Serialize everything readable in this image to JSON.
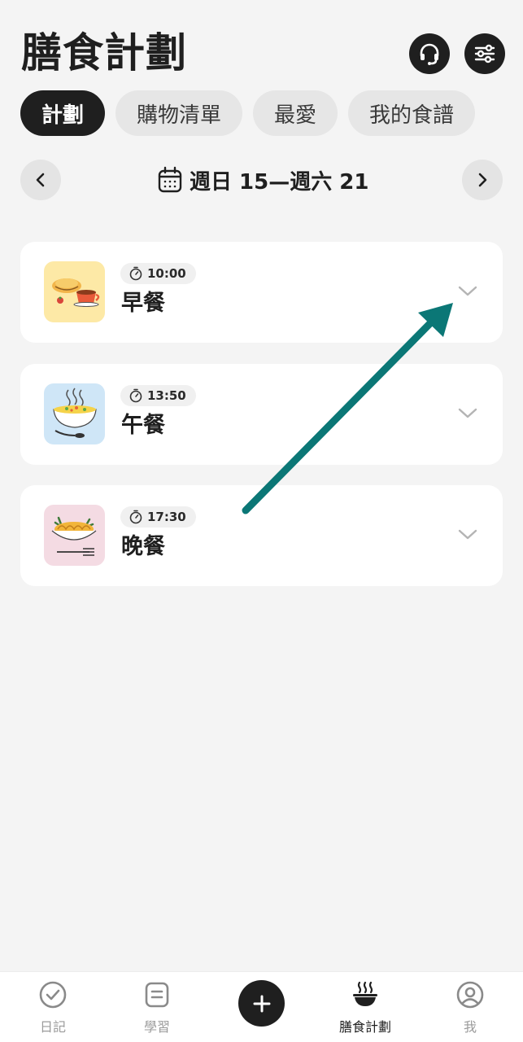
{
  "header": {
    "title": "膳食計劃",
    "support_icon": "headset-icon",
    "settings_icon": "sliders-icon"
  },
  "tabs": [
    {
      "label": "計劃",
      "active": true
    },
    {
      "label": "購物清單",
      "active": false
    },
    {
      "label": "最愛",
      "active": false
    },
    {
      "label": "我的食譜",
      "active": false
    }
  ],
  "week": {
    "label": "週日 15—週六 21",
    "calendar_icon": "calendar-icon"
  },
  "meals": [
    {
      "time": "10:00",
      "name": "早餐",
      "thumb_bg": "#fde9a6",
      "image": "pastry-and-coffee"
    },
    {
      "time": "13:50",
      "name": "午餐",
      "thumb_bg": "#cfe6f7",
      "image": "soup-bowl"
    },
    {
      "time": "17:30",
      "name": "晚餐",
      "thumb_bg": "#f4dbe3",
      "image": "pasta-plate"
    }
  ],
  "annotation": {
    "color": "#0b7776",
    "shape": "arrow"
  },
  "bottom_nav": [
    {
      "label": "日記",
      "icon": "check-circle-icon",
      "active": false
    },
    {
      "label": "學習",
      "icon": "document-icon",
      "active": false
    },
    {
      "label": "膳食計劃",
      "icon": "steaming-bowl-icon",
      "active": true
    },
    {
      "label": "我",
      "icon": "user-circle-icon",
      "active": false
    }
  ],
  "add_button": {
    "icon": "plus-icon"
  },
  "colors": {
    "background": "#f4f4f4",
    "primary_dark": "#1f1f1f",
    "tab_inactive": "#e6e6e6",
    "inactive_text": "#9b9b9b"
  }
}
